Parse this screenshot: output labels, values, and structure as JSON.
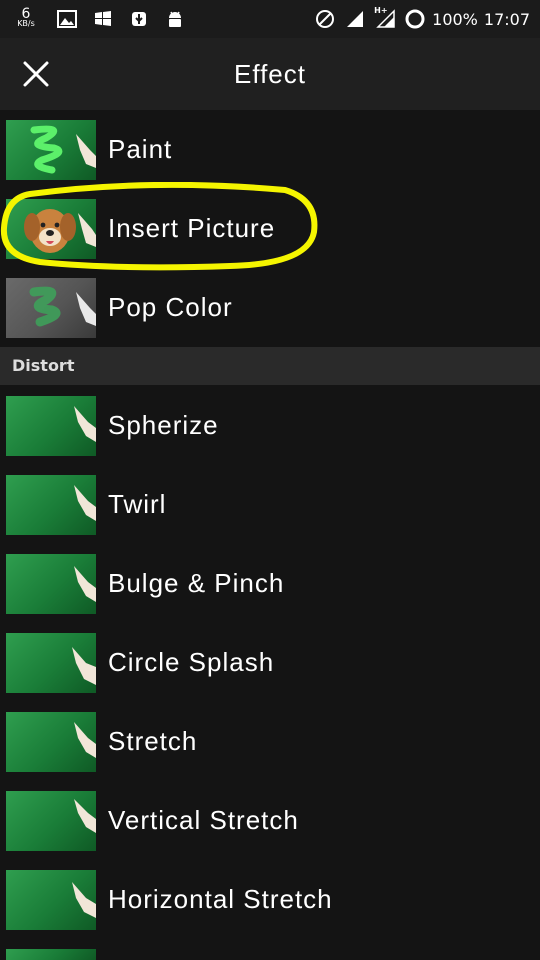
{
  "status": {
    "speed_value": "6",
    "speed_unit": "KB/s",
    "battery": "100%",
    "time": "17:07",
    "network": "H+"
  },
  "toolbar": {
    "title": "Effect"
  },
  "effects": [
    {
      "label": "Paint"
    },
    {
      "label": "Insert Picture"
    },
    {
      "label": "Pop Color"
    }
  ],
  "section": {
    "label": "Distort"
  },
  "distort": [
    {
      "label": "Spherize"
    },
    {
      "label": "Twirl"
    },
    {
      "label": "Bulge & Pinch"
    },
    {
      "label": "Circle Splash"
    },
    {
      "label": "Stretch"
    },
    {
      "label": "Vertical Stretch"
    },
    {
      "label": "Horizontal Stretch"
    }
  ],
  "colors": {
    "highlight": "#f5f500",
    "thumb_green": "#1f8a3f"
  }
}
